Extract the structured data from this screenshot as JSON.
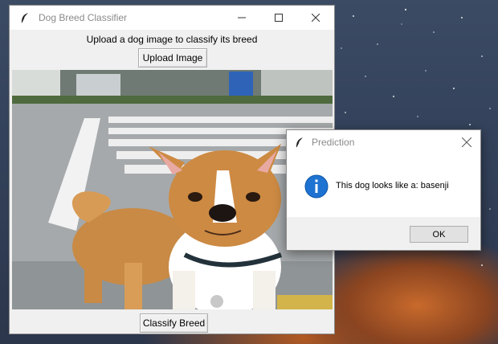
{
  "main_window": {
    "title": "Dog Breed Classifier",
    "prompt_text": "Upload a dog image to classify its breed",
    "upload_button_label": "Upload Image",
    "classify_button_label": "Classify Breed",
    "window_controls": [
      "minimize-icon",
      "maximize-icon",
      "close-icon"
    ]
  },
  "dialog": {
    "title": "Prediction",
    "message": "This dog looks like a: basenji",
    "ok_button_label": "OK",
    "icon": "info-icon"
  },
  "colors": {
    "info_blue": "#1e73d2",
    "window_bg": "#f0f0f0",
    "titlebar_text": "#8a8a8a"
  }
}
